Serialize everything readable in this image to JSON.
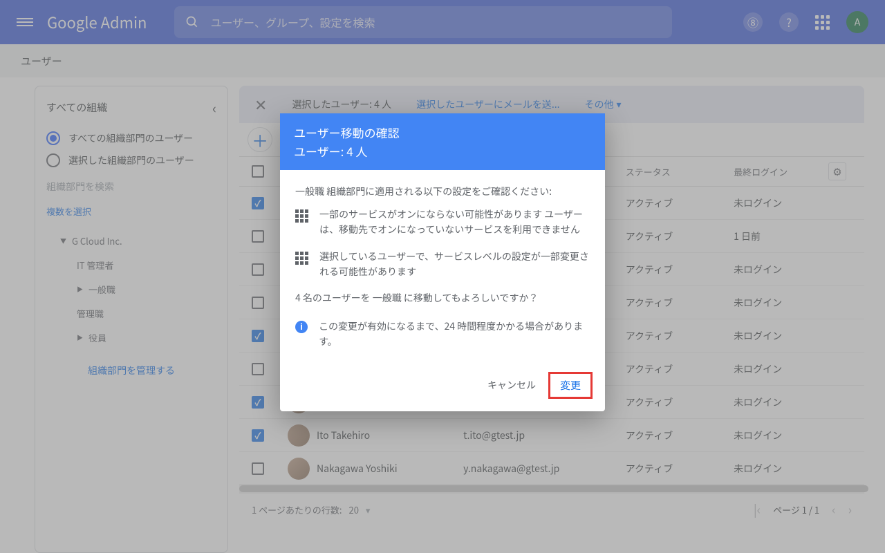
{
  "header": {
    "logo": "Google Admin",
    "search_placeholder": "ユーザー、グループ、設定を検索",
    "avatar_initial": "A"
  },
  "subheader": {
    "title": "ユーザー"
  },
  "sidebar": {
    "title": "すべての組織",
    "radio1": "すべての組織部門のユーザー",
    "radio2": "選択した組織部門のユーザー",
    "search_placeholder": "組織部門を検索",
    "select_multi": "複数を選択",
    "org_root": "G Cloud Inc.",
    "org_items": [
      "IT 管理者",
      "一般職",
      "管理職",
      "役員"
    ],
    "manage_link": "組織部門を管理する"
  },
  "selection_bar": {
    "selected_count": "選択したユーザー: 4 人",
    "email_action": "選択したユーザーにメールを送...",
    "more": "その他"
  },
  "table": {
    "headers": {
      "status": "ステータス",
      "login": "最終ログイン"
    },
    "rows": [
      {
        "checked": true,
        "name": "",
        "email": "",
        "status": "アクティブ",
        "login": "未ログイン"
      },
      {
        "checked": false,
        "name": "",
        "email": "",
        "status": "アクティブ",
        "login": "1 日前"
      },
      {
        "checked": false,
        "name": "",
        "email": "",
        "status": "アクティブ",
        "login": "未ログイン"
      },
      {
        "checked": false,
        "name": "",
        "email": "",
        "status": "アクティブ",
        "login": "未ログイン"
      },
      {
        "checked": true,
        "name": "",
        "email": "",
        "status": "アクティブ",
        "login": "未ログイン"
      },
      {
        "checked": false,
        "name": "",
        "email": "",
        "status": "アクティブ",
        "login": "未ログイン"
      },
      {
        "checked": true,
        "name": "",
        "email": "",
        "status": "アクティブ",
        "login": "未ログイン"
      },
      {
        "checked": true,
        "name": "Ito Takehiro",
        "email": "t.ito@gtest.jp",
        "status": "アクティブ",
        "login": "未ログイン"
      },
      {
        "checked": false,
        "name": "Nakagawa Yoshiki",
        "email": "y.nakagawa@gtest.jp",
        "status": "アクティブ",
        "login": "未ログイン"
      }
    ]
  },
  "pagination": {
    "rows_label": "1 ページあたりの行数:",
    "rows_value": "20",
    "page": "ページ 1 / 1"
  },
  "dialog": {
    "title_line1": "ユーザー移動の確認",
    "title_line2": "ユーザー: 4 人",
    "intro": "一般職 組織部門に適用される以下の設定をご確認ください:",
    "item1": "一部のサービスがオンにならない可能性があります ユーザーは、移動先でオンになっていないサービスを利用できません",
    "item2": "選択しているユーザーで、サービスレベルの設定が一部変更される可能性があります",
    "confirm": "4 名のユーザーを 一般職 に移動してもよろしいですか？",
    "info_note": "この変更が有効になるまで、24 時間程度かかる場合があります。",
    "cancel": "キャンセル",
    "change": "変更"
  }
}
